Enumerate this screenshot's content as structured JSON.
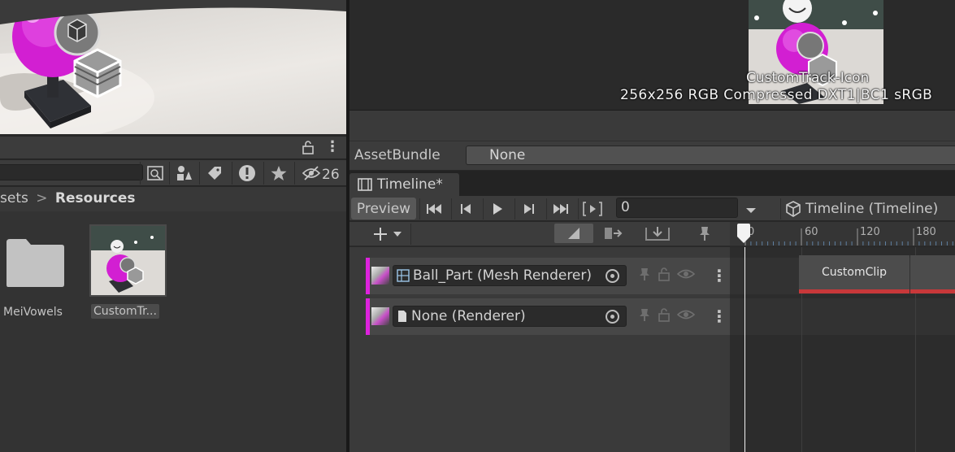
{
  "project": {
    "hidden_count": "26",
    "breadcrumb": {
      "parent": "sets",
      "separator": ">",
      "current": "Resources"
    },
    "assets": [
      {
        "label": "MeiVowels",
        "kind": "folder"
      },
      {
        "label": "CustomTr...",
        "kind": "texture",
        "selected": true
      }
    ]
  },
  "inspector": {
    "preview_name": "CustomTrack-Icon",
    "preview_info": "256x256  RGB Compressed DXT1|BC1 sRGB",
    "assetbundle_label": "AssetBundle",
    "assetbundle_value": "None"
  },
  "timeline": {
    "tab_label": "Timeline*",
    "preview_label": "Preview",
    "frame_value": "0",
    "asset_label": "Timeline (Timeline)",
    "ruler_ticks": [
      "0",
      "60",
      "120",
      "180"
    ],
    "tracks": [
      {
        "binding": "Ball_Part (Mesh Renderer)",
        "binding_icon": "mesh-renderer-icon",
        "clips": [
          {
            "label": "CustomClip"
          },
          {
            "label": ""
          }
        ]
      },
      {
        "binding": "None (Renderer)",
        "binding_icon": "file-icon",
        "clips": []
      }
    ]
  },
  "colors": {
    "track_accent": "#dd22dd",
    "clip_underline": "#c8383a",
    "panel_bg": "#3c3c3c",
    "dark_bg": "#282828"
  }
}
